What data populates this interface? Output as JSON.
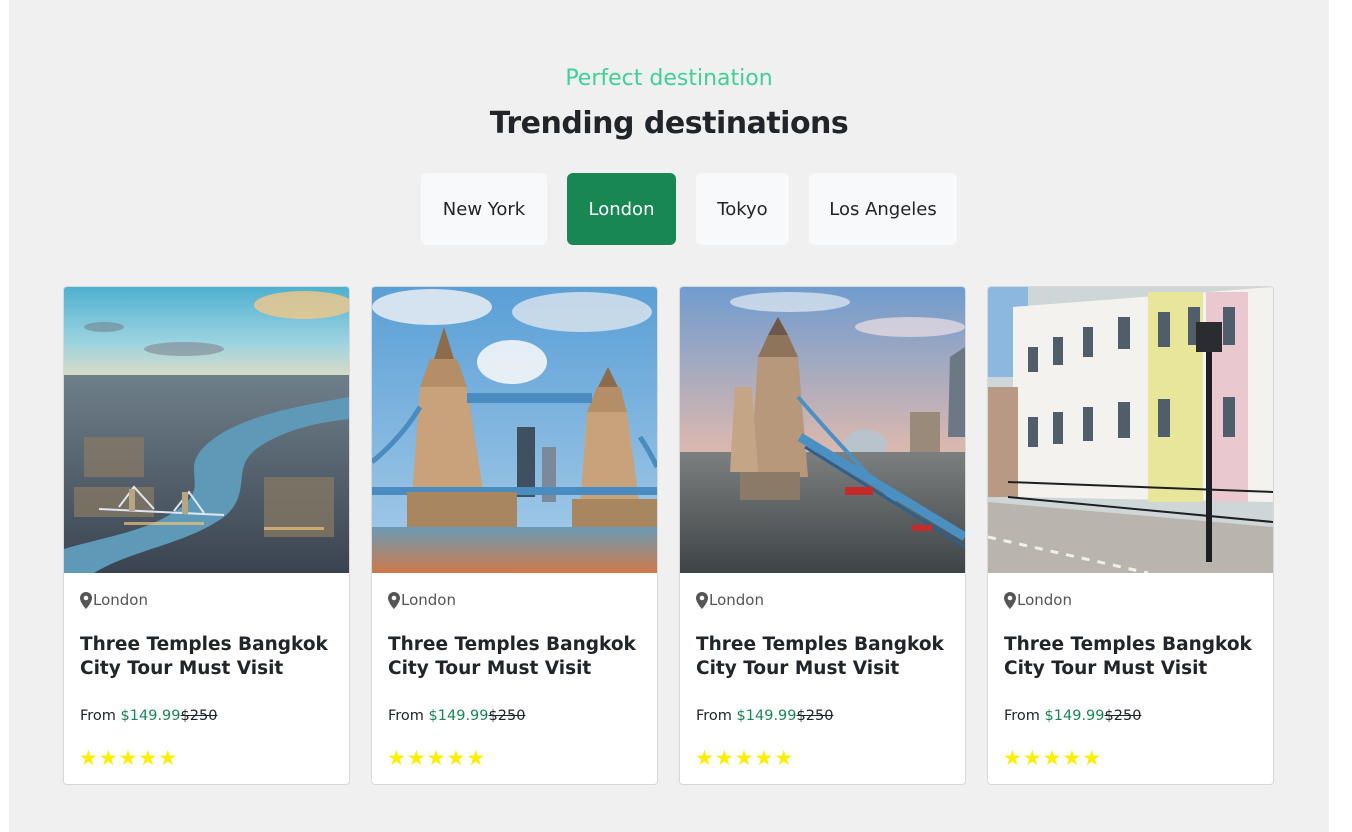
{
  "header": {
    "eyebrow": "Perfect destination",
    "title": "Trending destinations"
  },
  "tabs": [
    {
      "label": "New York",
      "active": false
    },
    {
      "label": "London",
      "active": true
    },
    {
      "label": "Tokyo",
      "active": false
    },
    {
      "label": "Los Angeles",
      "active": false
    }
  ],
  "cards": [
    {
      "location": "London",
      "title": "Three Temples Bangkok City Tour Must Visit",
      "price_prefix": "From",
      "price": "$149.99",
      "old_price": "$250",
      "rating": 5,
      "image": "london-aerial-thames"
    },
    {
      "location": "London",
      "title": "Three Temples Bangkok City Tour Must Visit",
      "price_prefix": "From",
      "price": "$149.99",
      "old_price": "$250",
      "rating": 5,
      "image": "tower-bridge-front"
    },
    {
      "location": "London",
      "title": "Three Temples Bangkok City Tour Must Visit",
      "price_prefix": "From",
      "price": "$149.99",
      "old_price": "$250",
      "rating": 5,
      "image": "tower-bridge-sunset"
    },
    {
      "location": "London",
      "title": "Three Temples Bangkok City Tour Must Visit",
      "price_prefix": "From",
      "price": "$149.99",
      "old_price": "$250",
      "rating": 5,
      "image": "london-terrace-street"
    }
  ],
  "colors": {
    "accent": "#198754",
    "eyebrow": "#3fcf9a",
    "star": "#ffee00",
    "section_bg": "#f0f0f0"
  },
  "icons": {
    "location": "map-pin-icon",
    "star": "star-icon"
  }
}
